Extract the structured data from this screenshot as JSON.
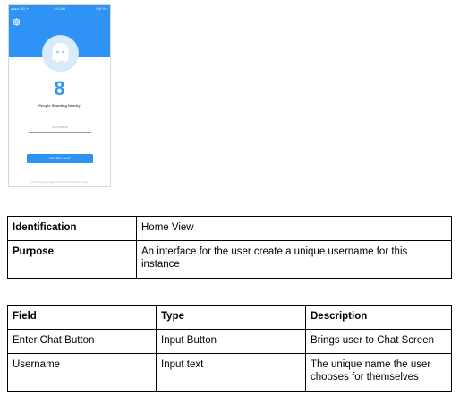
{
  "phone": {
    "status": {
      "left": "●●●●○ 3G ᯤ",
      "time": "9:41 AM",
      "right": "⌖ 56 % ▭"
    },
    "count": "8",
    "count_caption": "People Shooting Nearby",
    "username_placeholder": "username",
    "enter_button_label": "ENTER CHAT",
    "footer_note": "by continuing you agree to our terms of service & privacy"
  },
  "info_table": {
    "rows": [
      {
        "label": "Identification",
        "value": "Home View"
      },
      {
        "label": "Purpose",
        "value": "An interface for the user create a unique username for this instance"
      }
    ]
  },
  "fields_table": {
    "headers": [
      "Field",
      "Type",
      "Description"
    ],
    "rows": [
      [
        "Enter Chat Button",
        "Input Button",
        "Brings user to Chat Screen"
      ],
      [
        "Username",
        "Input text",
        "The unique name the user chooses for themselves"
      ]
    ]
  },
  "colors": {
    "accent": "#2f92f5",
    "avatar_bg": "#dbeaf9"
  },
  "icons": {
    "settings": "gear-icon",
    "avatar": "ghost-avatar-icon"
  }
}
